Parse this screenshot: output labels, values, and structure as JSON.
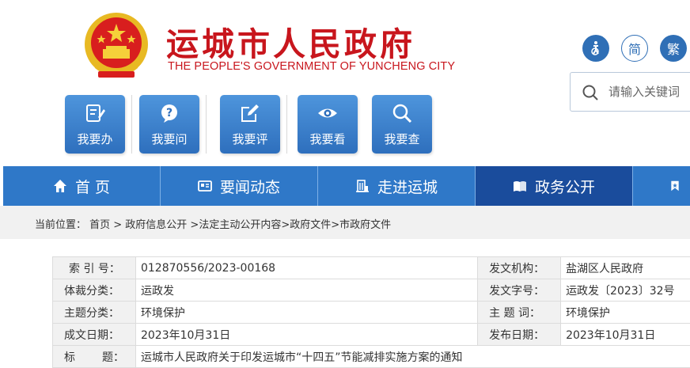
{
  "header": {
    "title": "运城市人民政府",
    "subtitle": "THE PEOPLE'S GOVERNMENT OF YUNCHENG  CITY",
    "accessibility_icon": "accessibility-icon",
    "simplified_label": "简",
    "traditional_label": "繁"
  },
  "search": {
    "placeholder": "请输入关键词"
  },
  "quick_links": [
    {
      "label": "我要办",
      "icon": "edit-document-icon"
    },
    {
      "label": "我要问",
      "icon": "question-bubble-icon"
    },
    {
      "label": "我要评",
      "icon": "pen-square-icon"
    },
    {
      "label": "我要看",
      "icon": "eye-icon"
    },
    {
      "label": "我要查",
      "icon": "search-icon"
    }
  ],
  "nav": [
    {
      "label": "首 页",
      "icon": "home-icon"
    },
    {
      "label": "要闻动态",
      "icon": "news-icon"
    },
    {
      "label": "走进运城",
      "icon": "building-icon"
    },
    {
      "label": "政务公开",
      "icon": "open-book-icon",
      "active": true
    },
    {
      "label": "",
      "icon": "bookmark-icon"
    }
  ],
  "breadcrumb": "当前位置： 首页 > 政府信息公开 >法定主动公开内容>政府文件>市政府文件",
  "meta": {
    "index_label": "索 引 号：",
    "index_value": "012870556/2023-00168",
    "issuer_label": "发文机构：",
    "issuer_value": "盐湖区人民政府",
    "category_label": "体裁分类：",
    "category_value": "运政发",
    "docno_label": "发文字号：",
    "docno_value": "运政发〔2023〕32号",
    "topic_label": "主题分类：",
    "topic_value": "环境保护",
    "keywords_label": "主 题 词：",
    "keywords_value": "环境保护",
    "created_label": "成文日期：",
    "created_value": "2023年10月31日",
    "published_label": "发布日期：",
    "published_value": "2023年10月31日",
    "title_label_a": "标",
    "title_label_b": "题：",
    "title_value": "运城市人民政府关于印发运城市“十四五”节能减排实施方案的通知"
  },
  "colors": {
    "brand_red": "#c8161d",
    "nav_blue": "#2f78c8",
    "nav_active": "#1a4c9c"
  }
}
